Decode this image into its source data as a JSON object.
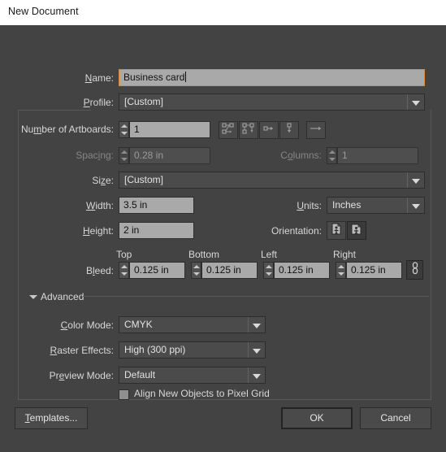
{
  "window": {
    "title": "New Document"
  },
  "fields": {
    "name": {
      "label": "Name:",
      "value": "Business card",
      "mnemonic": "N"
    },
    "profile": {
      "label": "Profile:",
      "value": "[Custom]",
      "mnemonic": "P"
    },
    "artboards": {
      "label": "Number of Artboards:",
      "value": "1",
      "mnemonic": "m",
      "arrange_icons": [
        "grid-by-row-icon",
        "grid-by-column-icon",
        "arrange-right-icon",
        "arrange-down-icon"
      ],
      "flow_icon": "arrow-right-icon"
    },
    "spacing": {
      "label": "Spacing:",
      "value": "0.28 in",
      "mnemonic": "i",
      "disabled": true
    },
    "columns": {
      "label": "Columns:",
      "value": "1",
      "mnemonic": "o",
      "disabled": true
    },
    "size": {
      "label": "Size:",
      "value": "[Custom]",
      "mnemonic": "z"
    },
    "width": {
      "label": "Width:",
      "value": "3.5 in",
      "mnemonic": "W"
    },
    "height": {
      "label": "Height:",
      "value": "2 in",
      "mnemonic": "H"
    },
    "units": {
      "label": "Units:",
      "value": "Inches",
      "mnemonic": "U"
    },
    "orientation": {
      "label": "Orientation:",
      "portrait_icon": "page-portrait-icon",
      "landscape_icon": "page-landscape-icon",
      "selected": "portrait"
    },
    "bleed": {
      "label": "Bleed:",
      "mnemonic": "l",
      "columns": [
        "Top",
        "Bottom",
        "Left",
        "Right"
      ],
      "values": [
        "0.125 in",
        "0.125 in",
        "0.125 in",
        "0.125 in"
      ],
      "link_icon": "chain-link-icon"
    }
  },
  "advanced": {
    "title": "Advanced",
    "expanded": true,
    "disclosure_icon": "triangle-down-icon",
    "color_mode": {
      "label": "Color Mode:",
      "value": "CMYK",
      "mnemonic": "C"
    },
    "raster_effects": {
      "label": "Raster Effects:",
      "value": "High (300 ppi)",
      "mnemonic": "R"
    },
    "preview_mode": {
      "label": "Preview Mode:",
      "value": "Default",
      "mnemonic": "e"
    },
    "align_pixel_grid": {
      "label": "Align New Objects to Pixel Grid",
      "mnemonic": "A",
      "checked": false
    }
  },
  "buttons": {
    "templates": {
      "label": "Templates...",
      "mnemonic": "T"
    },
    "ok": {
      "label": "OK"
    },
    "cancel": {
      "label": "Cancel"
    }
  },
  "colors": {
    "dialog_background": "#434343",
    "titlebar_background": "#ffffff",
    "input_background": "#a9a9a9",
    "combo_background": "#4b4b4b",
    "focus_border": "#e08b2b",
    "label_text": "#d8d8d8",
    "disabled_text": "#868686"
  }
}
